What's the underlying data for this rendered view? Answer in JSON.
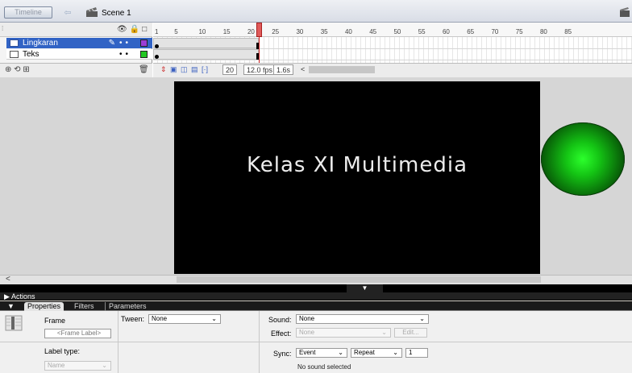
{
  "topbar": {
    "timeline_button": "Timeline",
    "scene_label": "Scene 1",
    "back_icon": "arrow-left-icon",
    "scene_icon": "clapper-icon",
    "edit_icon": "edit-scene-icon"
  },
  "timeline": {
    "layers": [
      {
        "name": "Lingkaran",
        "selected": true,
        "color": "#9b3dd6"
      },
      {
        "name": "Teks",
        "selected": false,
        "color": "#22c722"
      }
    ],
    "ruler_ticks": [
      "1",
      "5",
      "10",
      "15",
      "20",
      "25",
      "30",
      "35",
      "40",
      "45",
      "50",
      "55",
      "60",
      "65",
      "70",
      "75",
      "80",
      "85"
    ],
    "playhead_frame": 20,
    "controls": {
      "current_frame": "20",
      "fps": "12.0 fps",
      "time": "1.6s",
      "scroll_left": "<"
    }
  },
  "stage": {
    "text": "Kelas XI Multimedia",
    "background": "#000000",
    "circle_color": "#22ff22",
    "hscroll_left": "<"
  },
  "panels": {
    "actions_label": "Actions",
    "tabs": [
      "Properties",
      "Filters",
      "Parameters"
    ],
    "active_tab": "Properties"
  },
  "properties": {
    "frame_label": "Frame",
    "frame_label_placeholder": "<Frame Label>",
    "label_type_label": "Label type:",
    "label_type_value": "Name",
    "tween_label": "Tween:",
    "tween_value": "None",
    "sound_label": "Sound:",
    "sound_value": "None",
    "effect_label": "Effect:",
    "effect_value": "None",
    "edit_button": "Edit...",
    "sync_label": "Sync:",
    "sync_value": "Event",
    "repeat_value": "Repeat",
    "repeat_count": "1",
    "sound_status": "No sound selected"
  }
}
